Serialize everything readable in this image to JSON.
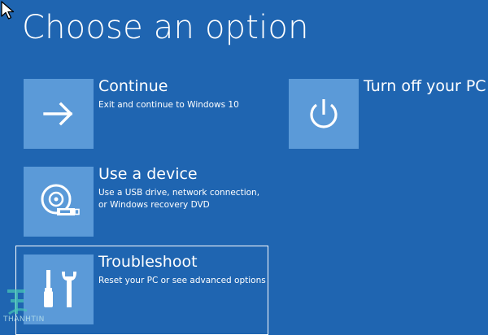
{
  "screen": {
    "title": "Choose an option",
    "background_color": "#1f65b1",
    "tile_color": "#5b9ad8"
  },
  "options": [
    {
      "id": "continue",
      "label": "Continue",
      "description": "Exit and continue to Windows 10",
      "icon": "arrow-right-icon"
    },
    {
      "id": "use-device",
      "label": "Use a device",
      "description": "Use a USB drive, network connection,\nor Windows recovery DVD",
      "icon": "disc-usb-icon"
    },
    {
      "id": "troubleshoot",
      "label": "Troubleshoot",
      "description": "Reset your PC or see advanced options",
      "icon": "tools-icon",
      "focused": true
    },
    {
      "id": "turn-off",
      "label": "Turn off your PC",
      "description": "",
      "icon": "power-icon"
    }
  ],
  "watermark": {
    "text": "THANHTIN",
    "icon": "watermark-logo"
  }
}
